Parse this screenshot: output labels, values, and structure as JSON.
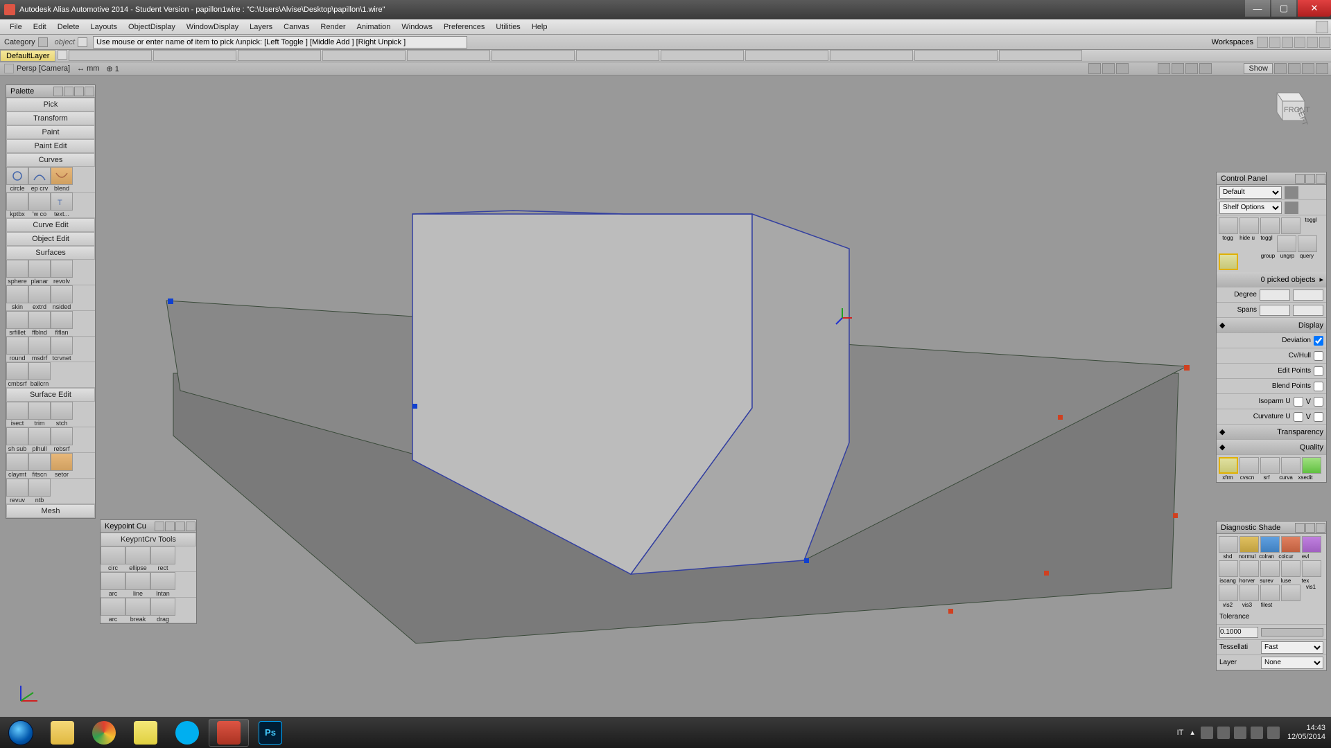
{
  "titlebar": {
    "text": "Autodesk Alias Automotive 2014   - Student Version   -  papillon1wire : \"C:\\Users\\Alvise\\Desktop\\papillon\\1.wire\""
  },
  "menu": [
    "File",
    "Edit",
    "Delete",
    "Layouts",
    "ObjectDisplay",
    "WindowDisplay",
    "Layers",
    "Canvas",
    "Render",
    "Animation",
    "Windows",
    "Preferences",
    "Utilities",
    "Help"
  ],
  "prompt": {
    "category": "Category",
    "pick": "object",
    "hint": "Use mouse or enter name of item to pick /unpick: [Left Toggle ] [Middle Add ] [Right Unpick ]",
    "workspaces": "Workspaces"
  },
  "layerbar": {
    "default": "DefaultLayer"
  },
  "statustop": {
    "view": "Persp [Camera]",
    "unit": "↔ mm",
    "snap": "⊕ 1",
    "show": "Show"
  },
  "palette": {
    "title": "Palette",
    "sections": [
      "Pick",
      "Transform",
      "Paint",
      "Paint Edit",
      "Curves"
    ],
    "curve_row1": [
      "circle",
      "ep crv",
      "blend"
    ],
    "curve_row2": [
      "kptbx",
      "'w co",
      "text..."
    ],
    "sections2": [
      "Curve Edit",
      "Object Edit",
      "Surfaces"
    ],
    "surf_row1": [
      "sphere",
      "planar",
      "revolv"
    ],
    "surf_row2": [
      "skin",
      "extrd",
      "nsided"
    ],
    "surf_row3": [
      "srfillet",
      "ffblnd",
      "flflan"
    ],
    "surf_row4": [
      "round",
      "msdrf",
      "tcrvnet"
    ],
    "surf_row5": [
      "cmbsrf",
      "ballcrn",
      ""
    ],
    "sections3": [
      "Surface Edit"
    ],
    "se_row1": [
      "isect",
      "trim",
      "stch"
    ],
    "se_row2": [
      "sh sub",
      "plhull",
      "rebsrf"
    ],
    "se_row3": [
      "claymt",
      "fitscn",
      "setor"
    ],
    "se_row4": [
      "revuv",
      "ntb",
      ""
    ],
    "sections4": [
      "Mesh"
    ]
  },
  "keypoint": {
    "title": "Keypoint Cu",
    "subtitle": "KeypntCrv Tools",
    "row1": [
      "circ",
      "ellipse",
      "rect"
    ],
    "row2": [
      "arc",
      "line",
      "lntan"
    ],
    "row3": [
      "arc",
      "break",
      "drag"
    ]
  },
  "control": {
    "title": "Control Panel",
    "default": "Default",
    "shelf": "Shelf Options",
    "shelf_row1": [
      "toggl",
      "togg",
      "hide u",
      "toggl"
    ],
    "shelf_row2": [
      "group",
      "ungrp",
      "query",
      ""
    ],
    "picked": "0 picked objects",
    "degree": "Degree",
    "spans": "Spans",
    "display": "Display",
    "rows": [
      {
        "label": "Deviation",
        "checked": true
      },
      {
        "label": "Cv/Hull",
        "checked": false
      },
      {
        "label": "Edit Points",
        "checked": false
      },
      {
        "label": "Blend Points",
        "checked": false
      }
    ],
    "isoparm": "Isoparm U",
    "curvature": "Curvature U",
    "v": "V",
    "transparency": "Transparency",
    "quality": "Quality",
    "bottom_row": [
      "xfrm",
      "cvscn",
      "srf",
      "curva",
      "xsedit"
    ]
  },
  "diag": {
    "title": "Diagnostic Shade",
    "row1": [
      "shd",
      "normul",
      "colran",
      "colcur",
      "evl"
    ],
    "row2": [
      "isoang",
      "horver",
      "surev",
      "luse",
      "tex"
    ],
    "row3": [
      "vis1",
      "vis2",
      "vis3",
      "filest"
    ],
    "tol": "Tolerance",
    "tolval": "0.1000",
    "tess": "Tessellati",
    "tessval": "Fast",
    "layer": "Layer",
    "layerval": "None"
  },
  "taskbar": {
    "lang": "IT",
    "time": "14:43",
    "date": "12/05/2014"
  }
}
